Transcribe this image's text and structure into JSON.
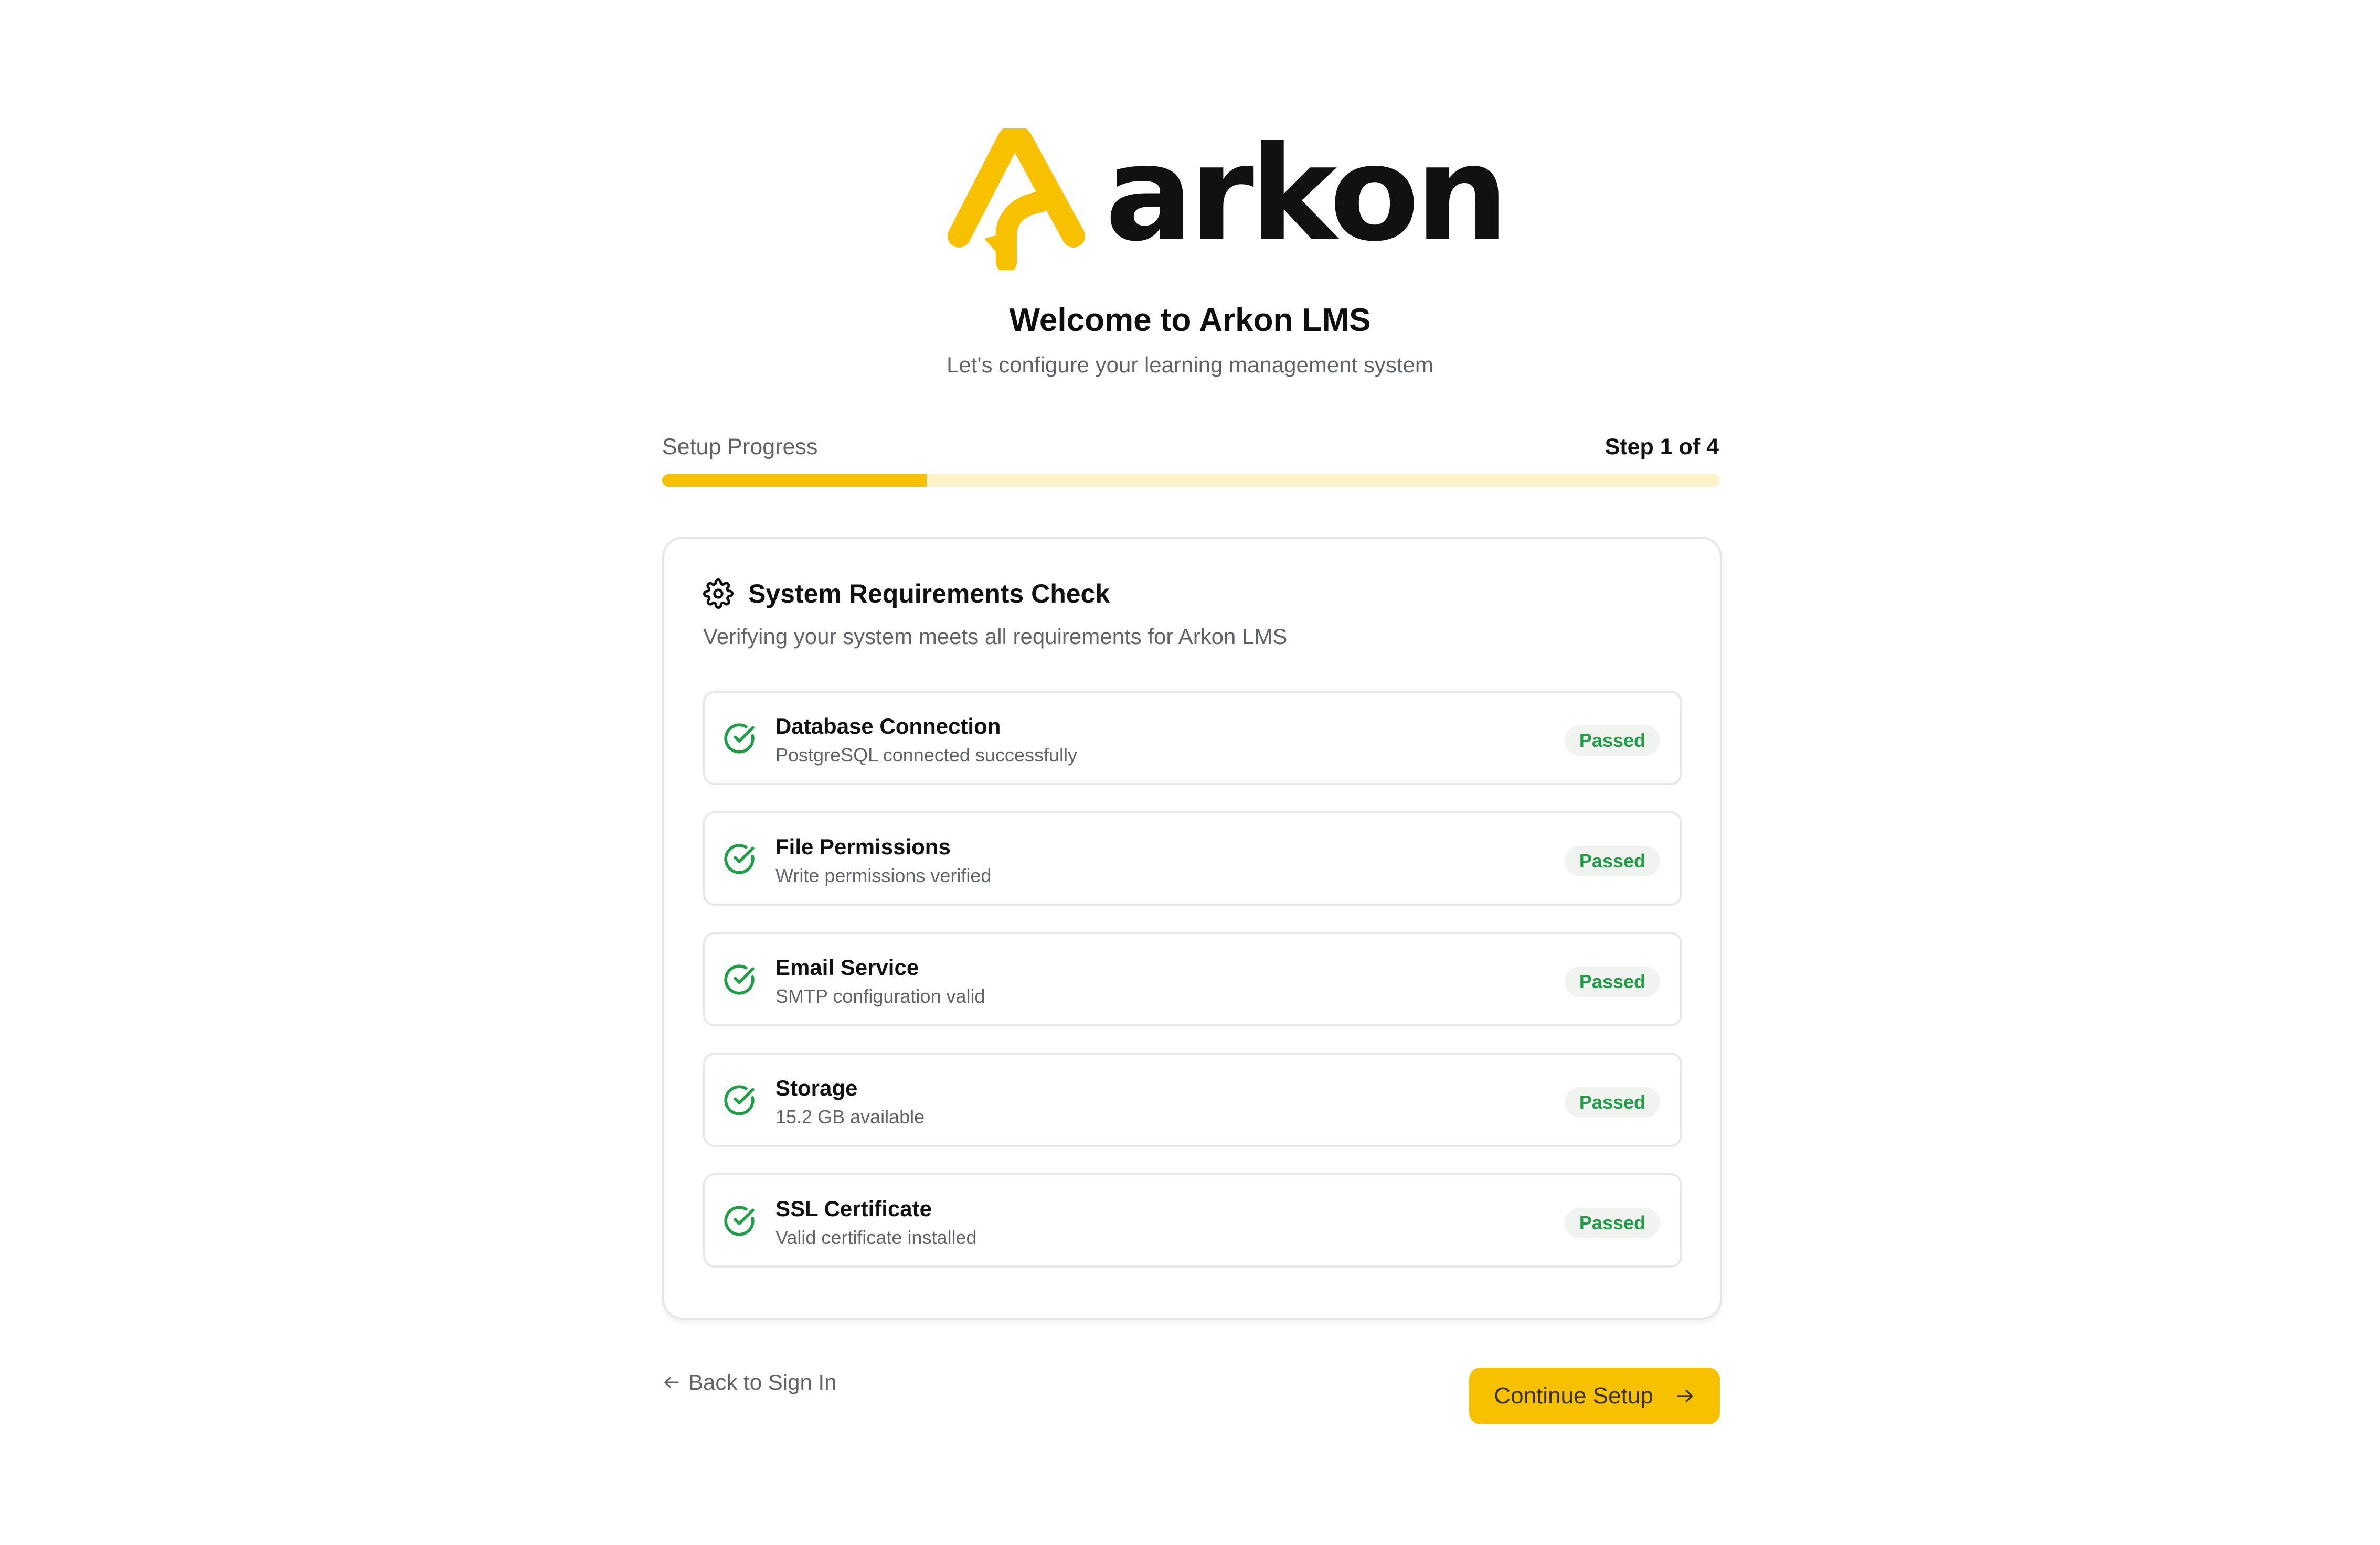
{
  "brand": {
    "wordmark": "arkon",
    "accent_color": "#f7c100"
  },
  "header": {
    "title": "Welcome to Arkon LMS",
    "subtitle": "Let's configure your learning management system"
  },
  "progress": {
    "label": "Setup Progress",
    "step_text": "Step 1 of 4",
    "fraction": 0.25
  },
  "requirements": {
    "title": "System Requirements Check",
    "description": "Verifying your system meets all requirements for Arkon LMS",
    "items": [
      {
        "name": "Database Connection",
        "detail": "PostgreSQL connected successfully",
        "status": "Passed"
      },
      {
        "name": "File Permissions",
        "detail": "Write permissions verified",
        "status": "Passed"
      },
      {
        "name": "Email Service",
        "detail": "SMTP configuration valid",
        "status": "Passed"
      },
      {
        "name": "Storage",
        "detail": "15.2 GB available",
        "status": "Passed"
      },
      {
        "name": "SSL Certificate",
        "detail": "Valid certificate installed",
        "status": "Passed"
      }
    ],
    "status_color": "#1f9d47",
    "icon": "check-circle-icon"
  },
  "footer": {
    "back_label": "Back to Sign In",
    "continue_label": "Continue Setup"
  }
}
